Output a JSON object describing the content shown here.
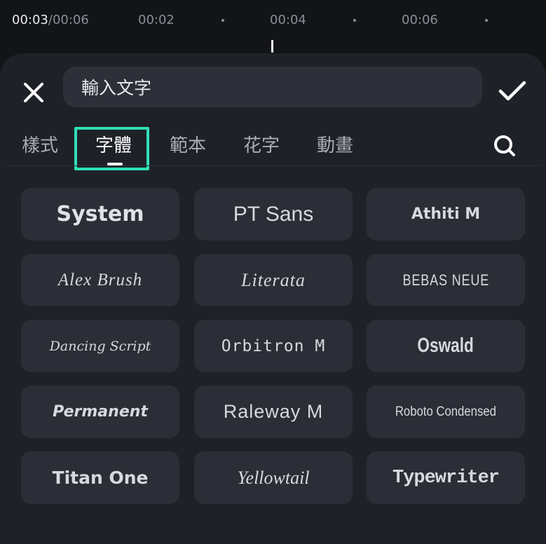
{
  "timeline": {
    "current_time": "00:03",
    "total_time": "/00:06",
    "ticks": [
      "00:02",
      "00:04",
      "00:06"
    ]
  },
  "editor": {
    "text_input_value": "輸入文字",
    "close_icon": "close-icon",
    "confirm_icon": "check-icon",
    "search_icon": "search-icon"
  },
  "tabs": [
    {
      "label": "樣式",
      "active": false
    },
    {
      "label": "字體",
      "active": true
    },
    {
      "label": "範本",
      "active": false
    },
    {
      "label": "花字",
      "active": false
    },
    {
      "label": "動畫",
      "active": false
    }
  ],
  "colors": {
    "accent_highlight": "#2fe0b4",
    "panel_bg": "#1f2128",
    "card_bg": "#2b2e36"
  },
  "fonts": [
    "System",
    "PT Sans",
    "Athiti M",
    "Alex Brush",
    "Literata",
    "BEBAS NEUE",
    "Dancing Script",
    "Orbitron M",
    "Oswald",
    "Permanent",
    "Raleway M",
    "Roboto Condensed",
    "Titan One",
    "Yellowtail",
    "Typewriter"
  ]
}
